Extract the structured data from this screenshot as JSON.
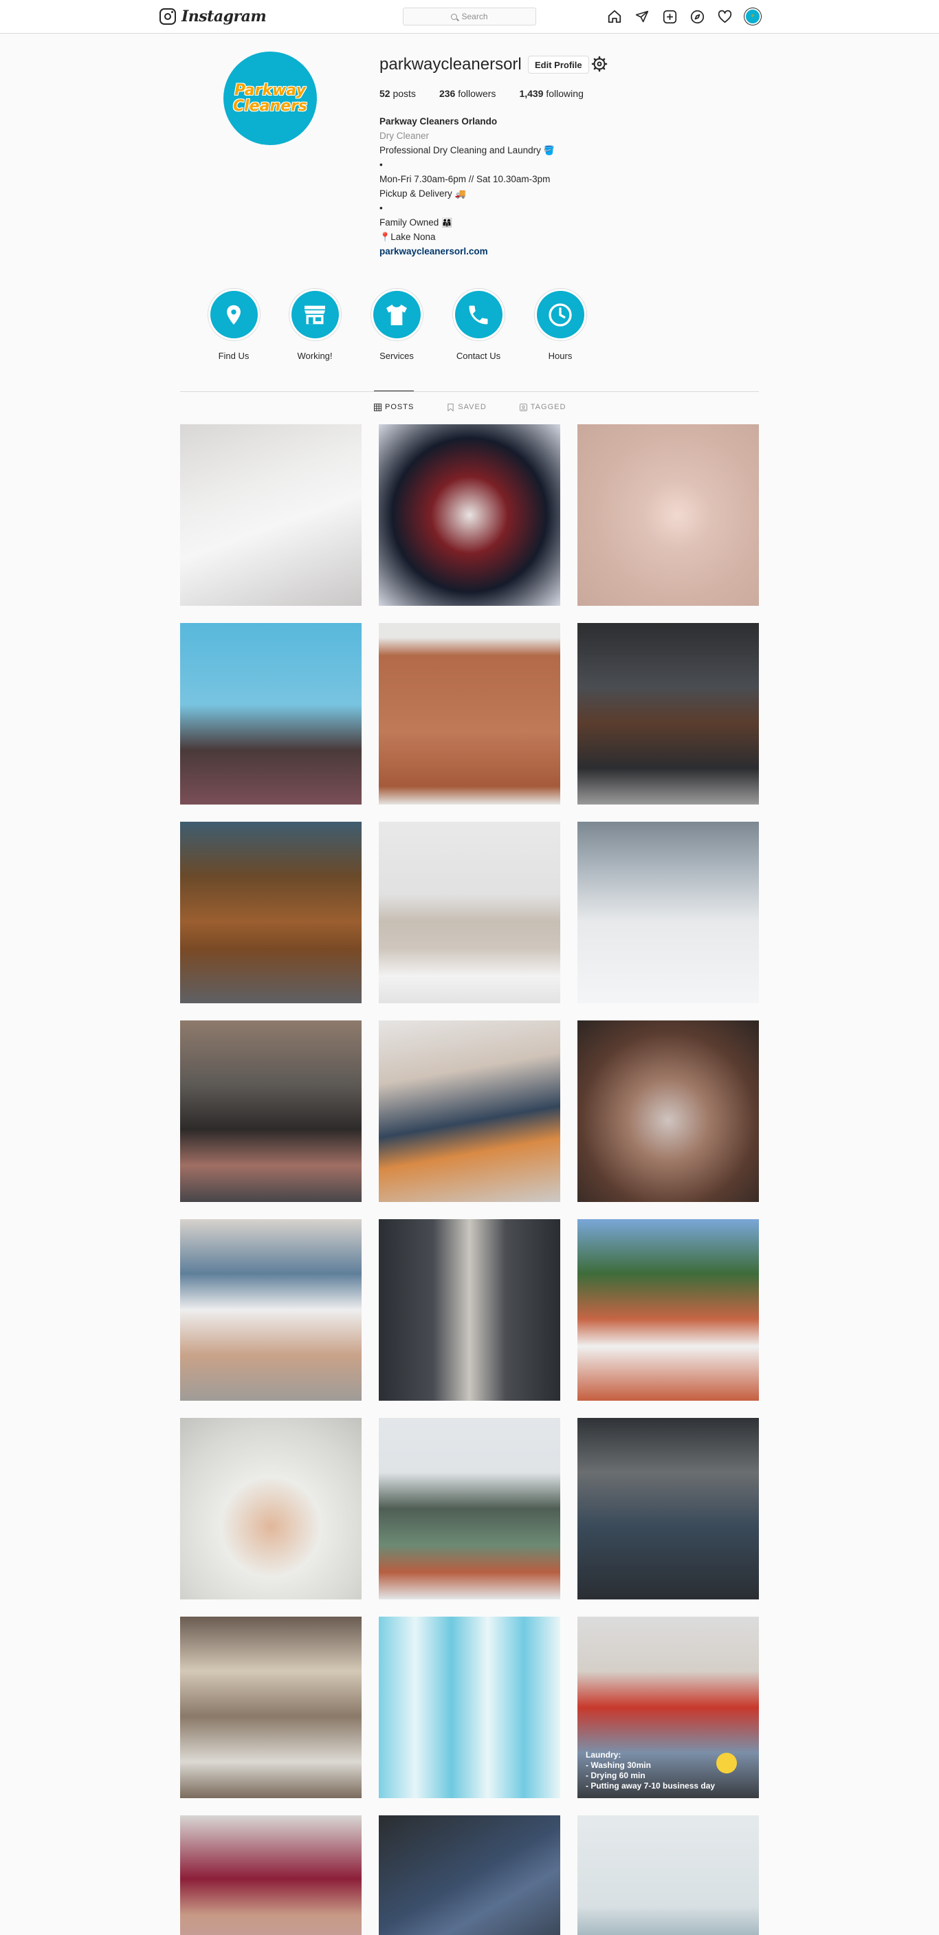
{
  "nav": {
    "logo_text": "Instagram",
    "search_placeholder": "Search",
    "icons": [
      "home-icon",
      "direct-icon",
      "new-post-icon",
      "explore-icon",
      "activity-icon",
      "profile-avatar"
    ]
  },
  "profile": {
    "username": "parkwaycleanersorl",
    "edit_label": "Edit Profile",
    "avatar_line1": "Parkway",
    "avatar_line2": "Cleaners",
    "stats": {
      "posts_count": "52",
      "posts_label": "posts",
      "followers_count": "236",
      "followers_label": "followers",
      "following_count": "1,439",
      "following_label": "following"
    },
    "full_name": "Parkway Cleaners Orlando",
    "category": "Dry Cleaner",
    "bio_line1": "Professional Dry Cleaning and Laundry",
    "dot1": "•",
    "bio_line2": "Mon-Fri 7.30am-6pm // Sat 10.30am-3pm",
    "bio_line3": "Pickup & Delivery",
    "dot2": "•",
    "bio_line4": "Family Owned",
    "bio_line5": "Lake Nona",
    "website": "parkwaycleanersorl.com"
  },
  "highlights": [
    {
      "label": "Find Us",
      "icon": "location-pin-icon"
    },
    {
      "label": "Working!",
      "icon": "store-icon"
    },
    {
      "label": "Services",
      "icon": "tshirt-icon"
    },
    {
      "label": "Contact Us",
      "icon": "phone-icon"
    },
    {
      "label": "Hours",
      "icon": "clock-icon"
    }
  ],
  "tabs": {
    "posts": "POSTS",
    "saved": "SAVED",
    "tagged": "TAGGED"
  },
  "post_caption": {
    "line1": "Laundry:",
    "line2": "- Washing 30min",
    "line3": "- Drying 60 min",
    "line4": "- Putting away 7-10 business day"
  },
  "colors": {
    "brand_teal": "#0bafcf",
    "brand_orange": "#f7a400",
    "link": "#00376b"
  }
}
